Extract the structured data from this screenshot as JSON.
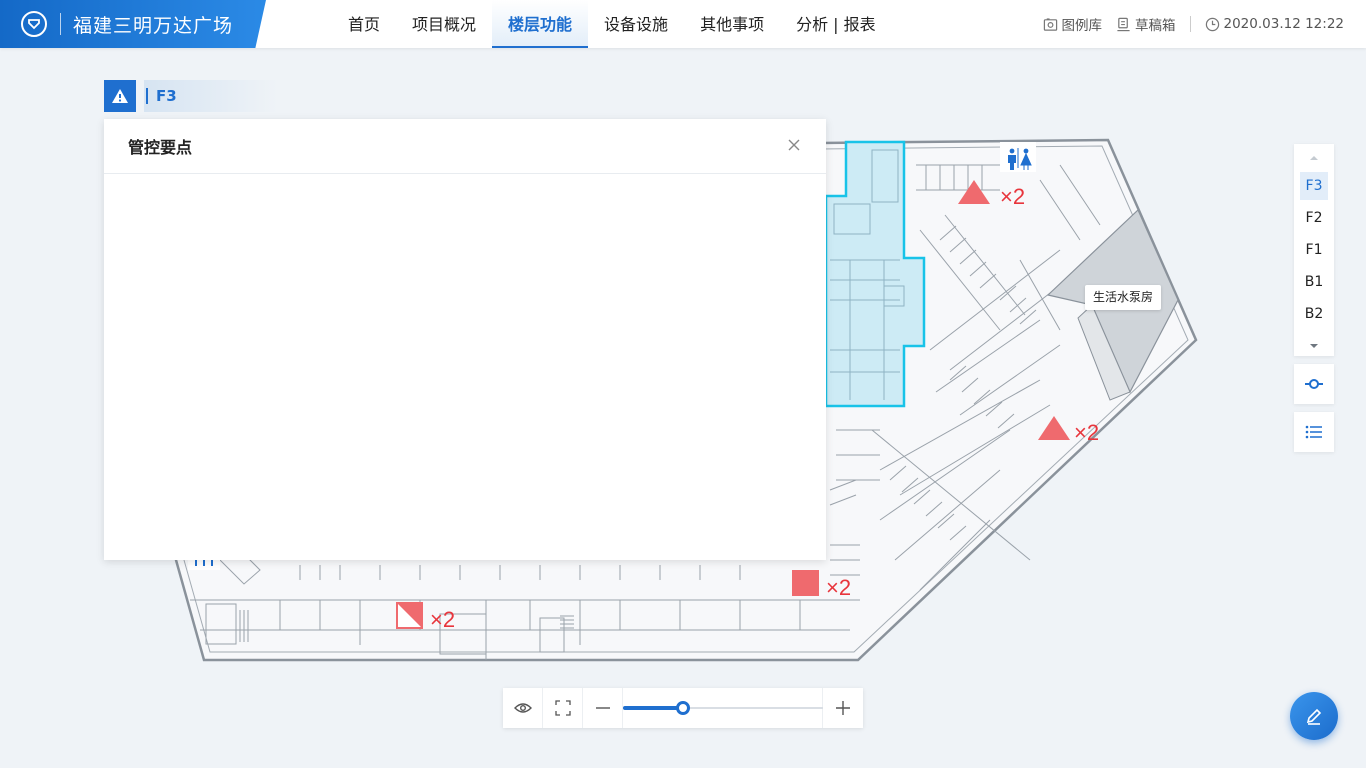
{
  "header": {
    "title": "福建三明万达广场",
    "nav": [
      {
        "label": "首页",
        "active": false
      },
      {
        "label": "项目概况",
        "active": false
      },
      {
        "label": "楼层功能",
        "active": true
      },
      {
        "label": "设备设施",
        "active": false
      },
      {
        "label": "其他事项",
        "active": false
      },
      {
        "label": "分析 | 报表",
        "active": false
      }
    ],
    "legend_label": "图例库",
    "draft_label": "草稿箱",
    "datetime": "2020.03.12 12:22"
  },
  "floor_tag": {
    "current": "F3"
  },
  "panel": {
    "title": "管控要点"
  },
  "floor_switch": {
    "items": [
      {
        "label": "F3",
        "active": true
      },
      {
        "label": "F2",
        "active": false
      },
      {
        "label": "F1",
        "active": false
      },
      {
        "label": "B1",
        "active": false
      },
      {
        "label": "B2",
        "active": false
      }
    ]
  },
  "map": {
    "room_label": "生活水泵房",
    "markers": [
      {
        "shape": "triangle",
        "count": "×2"
      },
      {
        "shape": "triangle",
        "count": "×2"
      },
      {
        "shape": "square",
        "count": "×2"
      },
      {
        "shape": "half-square",
        "count": "×2"
      }
    ]
  },
  "zoom": {
    "level": 0.3
  },
  "colors": {
    "accent": "#1f6fcf",
    "marker": "#ef6a6e",
    "highlight_zone": "#cdebf5",
    "highlight_border": "#18c3e8"
  },
  "icons": [
    "warning-icon",
    "picture-icon",
    "draft-icon",
    "clock-icon",
    "close-icon",
    "route-icon",
    "list-icon",
    "eye-icon",
    "fullscreen-icon",
    "minus-icon",
    "plus-icon",
    "edit-icon",
    "restroom-icon"
  ]
}
